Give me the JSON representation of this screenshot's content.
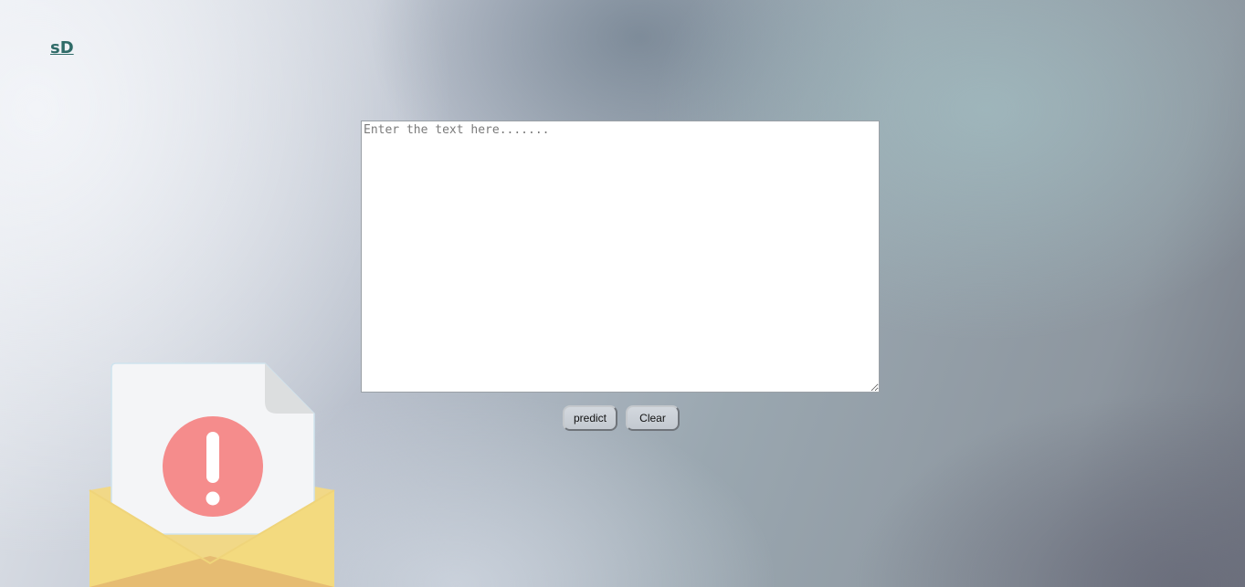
{
  "header": {
    "brand_link": "sD"
  },
  "form": {
    "textarea": {
      "placeholder": "Enter the text here.......",
      "value": ""
    },
    "buttons": {
      "predict_label": "predict",
      "clear_label": "Clear"
    }
  },
  "illustration": {
    "icon": "envelope-warning-icon",
    "colors": {
      "envelope": "#f4d97e",
      "alert_circle": "#f58c8c",
      "paper": "#f5f6f8"
    }
  }
}
